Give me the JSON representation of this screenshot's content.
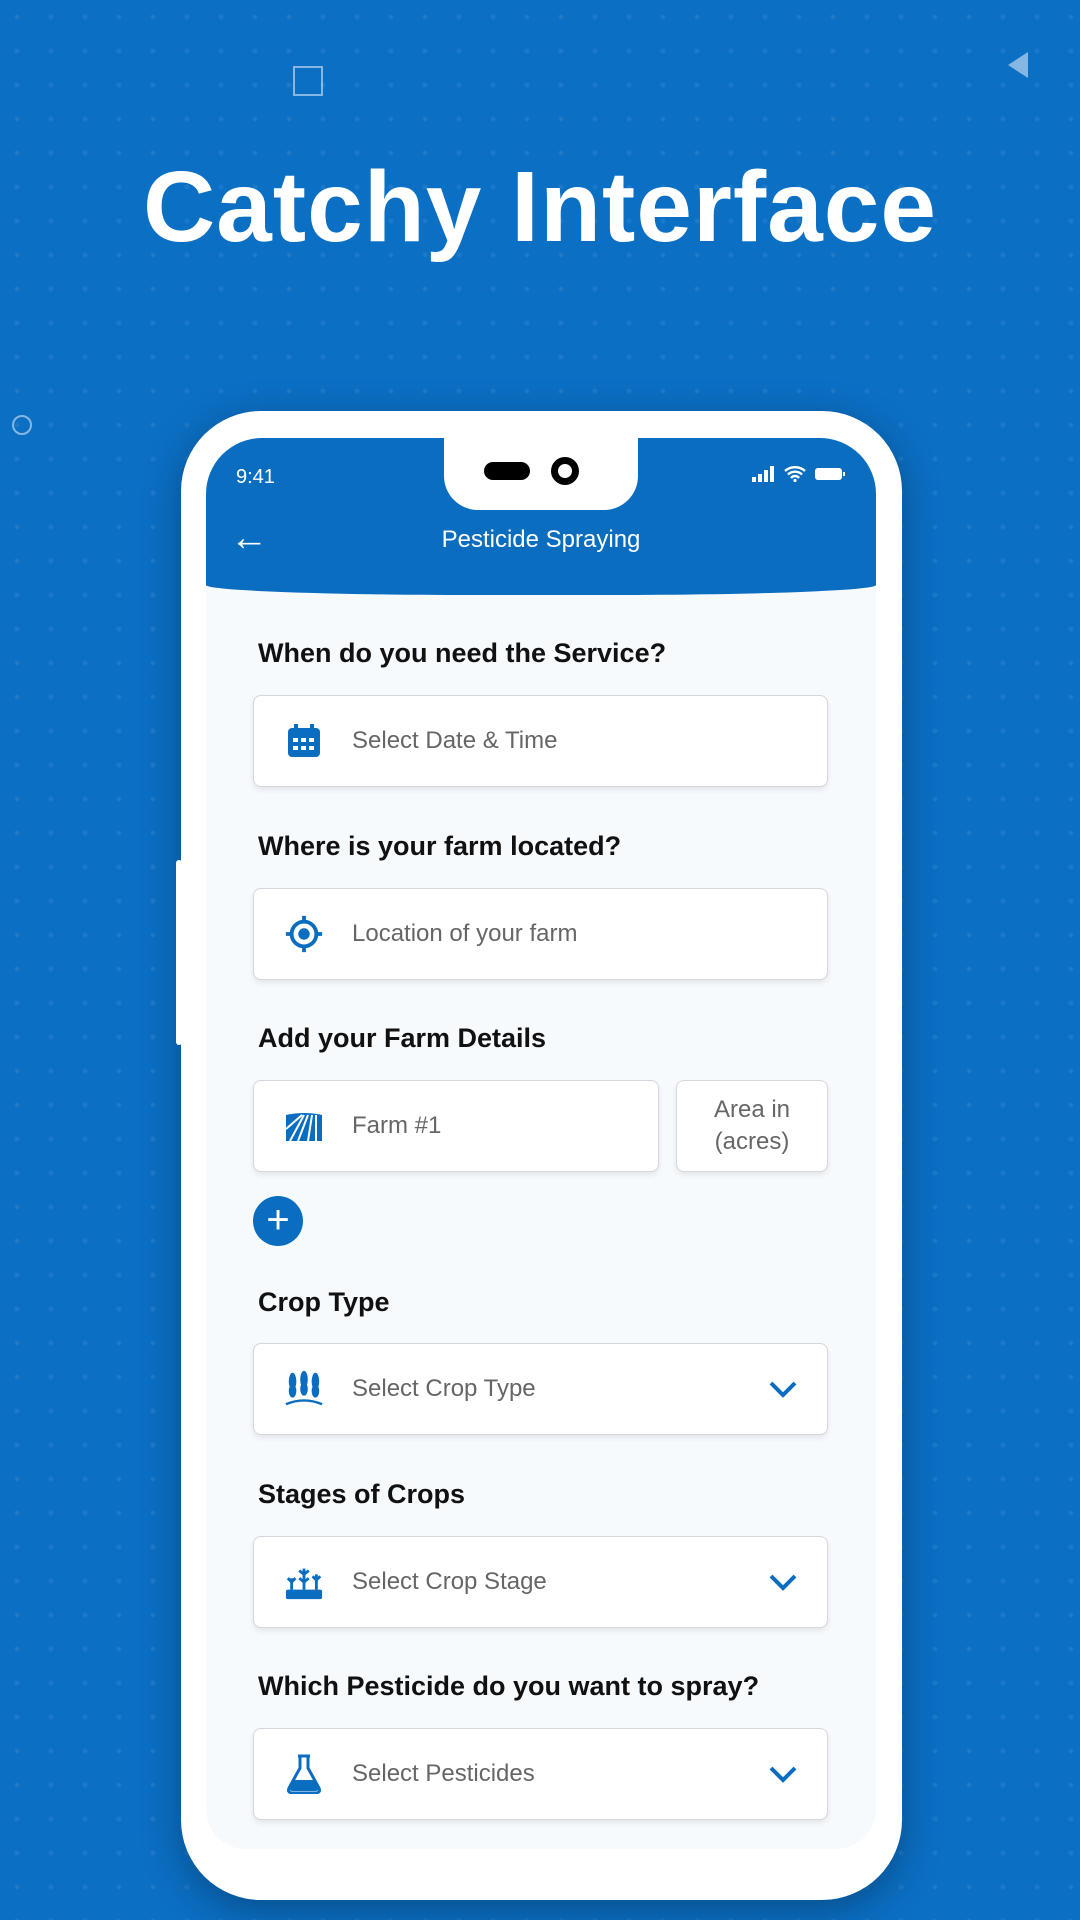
{
  "headline": "Catchy Interface",
  "status_bar": {
    "time": "9:41"
  },
  "app_bar": {
    "title": "Pesticide Spraying"
  },
  "form": {
    "q_service": "When do you need the Service?",
    "date_placeholder": "Select Date & Time",
    "q_location": "Where is your farm located?",
    "location_placeholder": "Location of your farm",
    "q_farm": "Add your Farm Details",
    "farm_placeholder": "Farm #1",
    "area_placeholder_1": "Area in",
    "area_placeholder_2": "(acres)",
    "add_label": "+",
    "q_crop": "Crop Type",
    "crop_placeholder": "Select Crop Type",
    "q_stage": "Stages of Crops",
    "stage_placeholder": "Select Crop Stage",
    "q_pesticide": "Which Pesticide do you want to spray?",
    "pesticide_placeholder": "Select Pesticides"
  },
  "colors": {
    "primary": "#0a6dc0",
    "background": "#0b6fc4"
  }
}
